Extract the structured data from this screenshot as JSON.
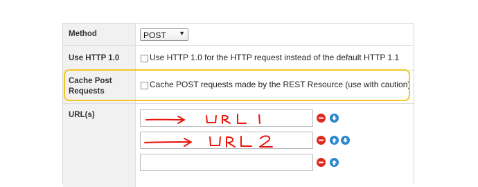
{
  "method": {
    "label": "Method",
    "selected": "POST"
  },
  "use_http_10": {
    "label": "Use HTTP 1.0",
    "checked": false,
    "checkbox_label": "Use HTTP 1.0 for the HTTP request instead of the default HTTP 1.1"
  },
  "cache_post": {
    "label_line1": "Cache Post",
    "label_line2": "Requests",
    "checked": false,
    "checkbox_label": "Cache POST requests made by the REST Resource (use with caution)",
    "highlight_color": "#f3c623"
  },
  "urls": {
    "label": "URL(s)",
    "items": [
      {
        "value": "",
        "annotation": "URL 1",
        "actions": [
          "remove",
          "move-down"
        ]
      },
      {
        "value": "",
        "annotation": "URL 2",
        "actions": [
          "remove",
          "move-up",
          "move-down"
        ]
      },
      {
        "value": "",
        "annotation": "",
        "actions": [
          "remove",
          "move-up"
        ]
      }
    ]
  },
  "colors": {
    "remove_button": "#dd2a20",
    "move_button": "#2c86d2",
    "annotation_ink": "#e8160c"
  }
}
